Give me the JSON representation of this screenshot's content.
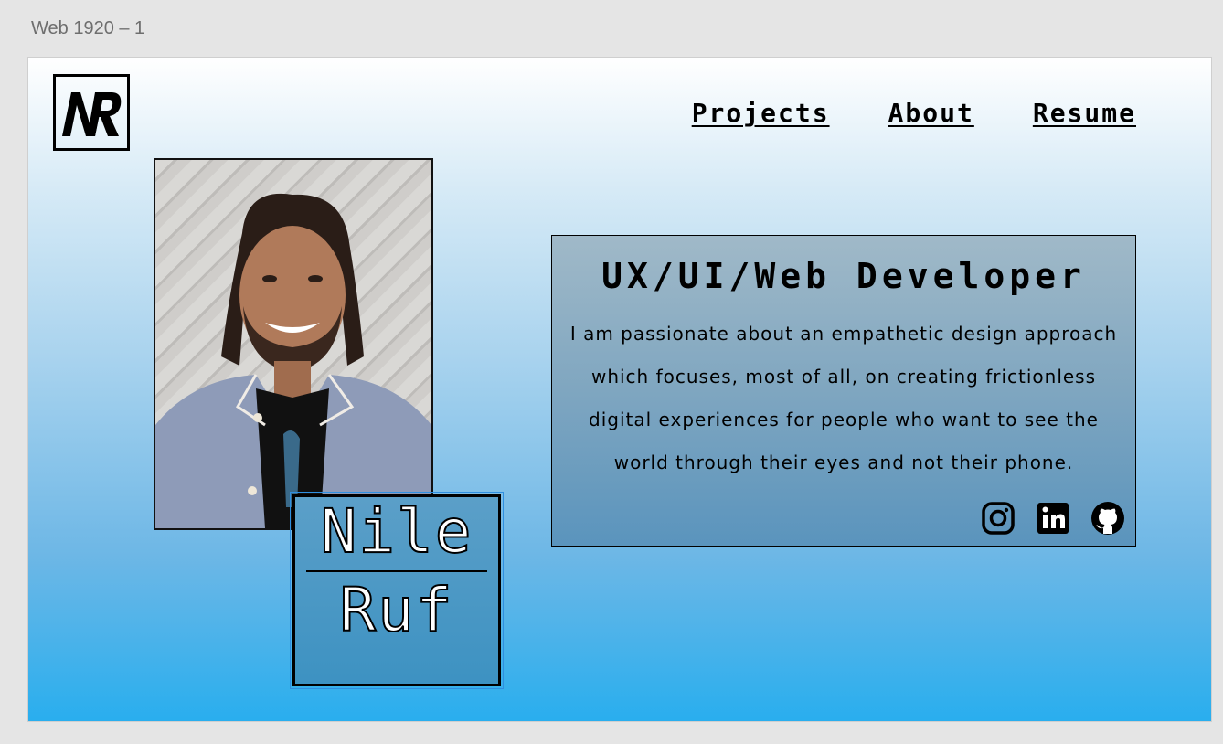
{
  "canvas": {
    "artboard_label": "Web 1920 – 1"
  },
  "logo": {
    "text": "NR"
  },
  "nav": {
    "items": [
      "Projects",
      "About",
      "Resume"
    ]
  },
  "name": {
    "first": "Nile",
    "last": "Ruf"
  },
  "intro": {
    "title": "UX/UI/Web Developer",
    "body": "I am passionate about an empathetic design approach which focuses, most of all, on creating frictionless digital experiences for people who want to see the world through their eyes and not their phone."
  },
  "socials": {
    "icons": [
      "instagram-icon",
      "linkedin-icon",
      "github-icon"
    ]
  }
}
